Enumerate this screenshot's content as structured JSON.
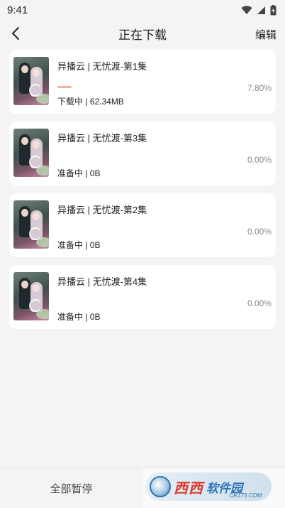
{
  "status_bar": {
    "time": "9:41"
  },
  "nav": {
    "title": "正在下载",
    "edit_label": "编辑"
  },
  "downloads": [
    {
      "title": "异播云 | 无忧渡-第1集",
      "status": "下载中 | 62.34MB",
      "percent": "7.80%",
      "progress": 0.078
    },
    {
      "title": "异播云 | 无忧渡-第3集",
      "status": "准备中 | 0B",
      "percent": "0.00%",
      "progress": 0
    },
    {
      "title": "异播云 | 无忧渡-第2集",
      "status": "准备中 | 0B",
      "percent": "0.00%",
      "progress": 0
    },
    {
      "title": "异播云 | 无忧渡-第4集",
      "status": "准备中 | 0B",
      "percent": "0.00%",
      "progress": 0
    }
  ],
  "bottom": {
    "pause_all_label": "全部暂停"
  },
  "watermark": {
    "brand": "西西",
    "site": "软件园",
    "url": "CR173.COM"
  },
  "colors": {
    "progress": "#f2b495",
    "background": "#f4f4f4",
    "card": "#ffffff"
  }
}
